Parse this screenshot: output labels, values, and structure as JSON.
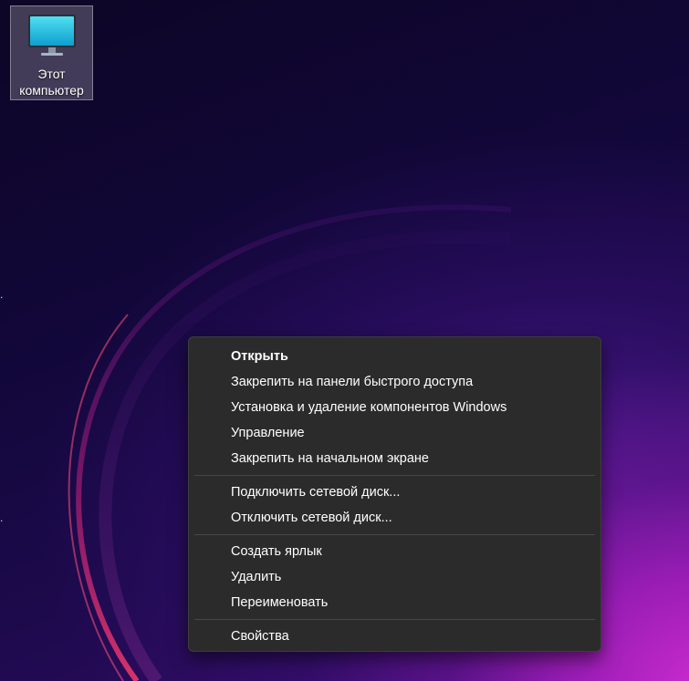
{
  "desktop": {
    "icon": {
      "label": "Этот компьютер",
      "icon_name": "monitor-icon"
    }
  },
  "context_menu": {
    "groups": [
      {
        "items": [
          {
            "label": "Открыть",
            "bold": true
          },
          {
            "label": "Закрепить на панели быстрого доступа"
          },
          {
            "label": "Установка и удаление компонентов Windows"
          },
          {
            "label": "Управление"
          },
          {
            "label": "Закрепить на начальном экране"
          }
        ]
      },
      {
        "items": [
          {
            "label": "Подключить сетевой диск..."
          },
          {
            "label": "Отключить сетевой диск..."
          }
        ]
      },
      {
        "items": [
          {
            "label": "Создать ярлык"
          },
          {
            "label": "Удалить"
          },
          {
            "label": "Переименовать"
          }
        ]
      },
      {
        "items": [
          {
            "label": "Свойства"
          }
        ]
      }
    ]
  },
  "colors": {
    "menu_background": "#2b2b2b",
    "menu_text": "#ffffff",
    "accent_magenta": "#d62ed6"
  }
}
